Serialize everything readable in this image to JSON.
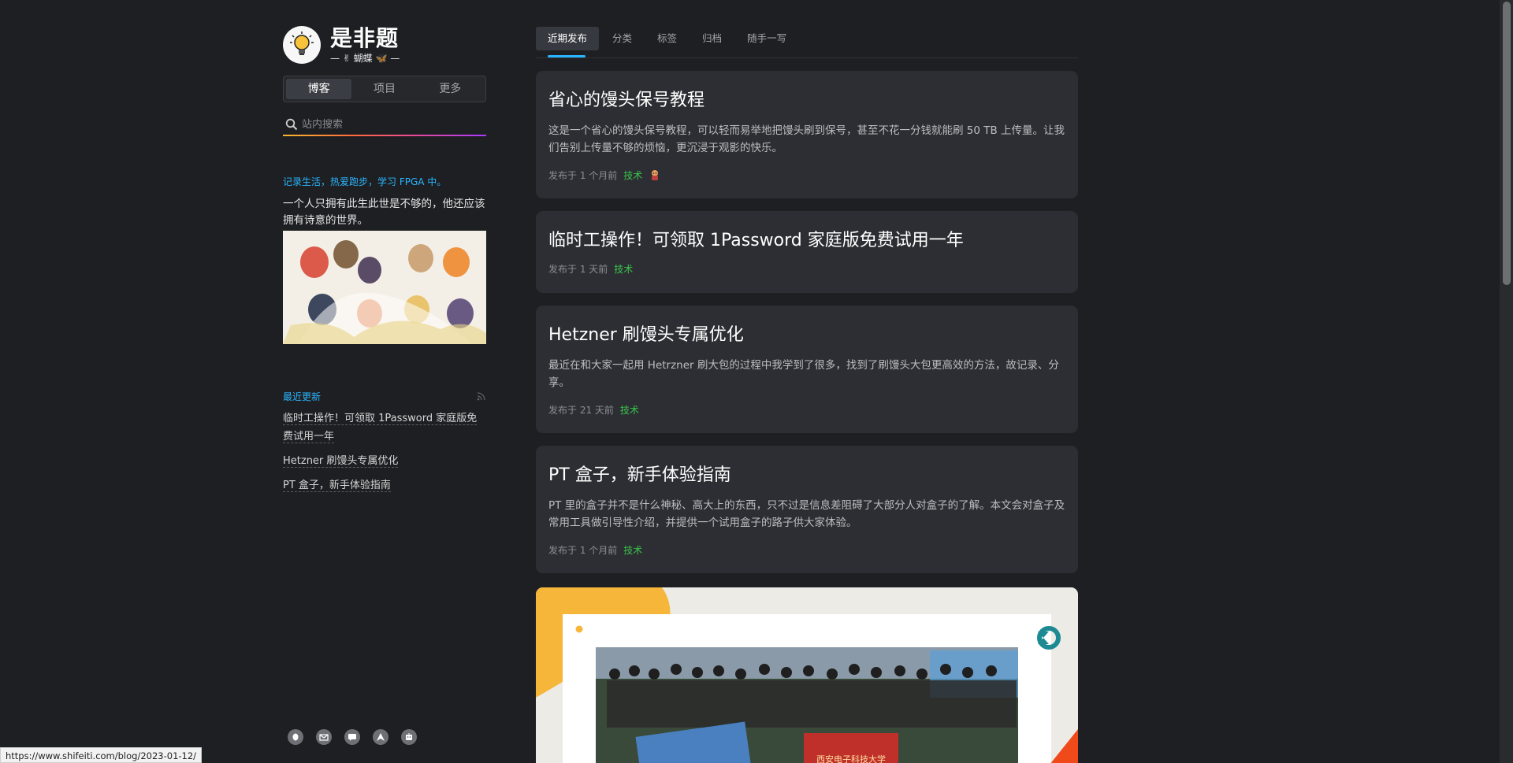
{
  "brand": {
    "title": "是非题",
    "subtitle": "— ✌ 蝴蝶 🦋 —"
  },
  "sidebar": {
    "tabs": [
      "博客",
      "项目",
      "更多"
    ],
    "search_placeholder": "站内搜索",
    "tagline": "记录生活，热爱跑步，学习 FPGA 中。",
    "quote": "一个人只拥有此生此世是不够的，他还应该拥有诗意的世界。",
    "recent_title": "最近更新",
    "recent_items": [
      "临时工操作！可领取 1Password 家庭版免费试用一年",
      "Hetzner 刷馒头专属优化",
      "PT 盒子，新手体验指南"
    ],
    "social_icons": [
      "qq-icon",
      "mail-icon",
      "chat-icon",
      "arch-icon",
      "robot-icon"
    ]
  },
  "nav": {
    "items": [
      "近期发布",
      "分类",
      "标签",
      "归档",
      "随手一写"
    ]
  },
  "posts": [
    {
      "title": "省心的馒头保号教程",
      "summary": "这是一个省心的馒头保号教程，可以轻而易举地把馒头刷到保号，甚至不花一分钱就能刷 50 TB 上传量。让我们告别上传量不够的烦恼，更沉浸于观影的快乐。",
      "date": "发布于 1 个月前",
      "tag": "技术"
    },
    {
      "title": "临时工操作！可领取 1Password 家庭版免费试用一年",
      "summary": "",
      "date": "发布于 1 天前",
      "tag": "技术"
    },
    {
      "title": "Hetzner 刷馒头专属优化",
      "summary": "最近在和大家一起用 Hetrzner 刷大包的过程中我学到了很多，找到了刷馒头大包更高效的方法，故记录、分享。",
      "date": "发布于 21 天前",
      "tag": "技术"
    },
    {
      "title": "PT 盒子，新手体验指南",
      "summary": "PT 里的盒子并不是什么神秘、高大上的东西，只不过是信息差阻碍了大部分人对盒子的了解。本文会对盒子及常用工具做引导性介绍，并提供一个试用盒子的路子供大家体验。",
      "date": "发布于 1 个月前",
      "tag": "技术"
    }
  ],
  "banner": {
    "banner_text": "西安电子科技大学"
  },
  "status_url": "https://www.shifeiti.com/blog/2023-01-12/",
  "colors": {
    "accent": "#2ab5ff",
    "tag": "#3bc44b",
    "card": "#2c2e33",
    "background": "#1e1f22"
  }
}
